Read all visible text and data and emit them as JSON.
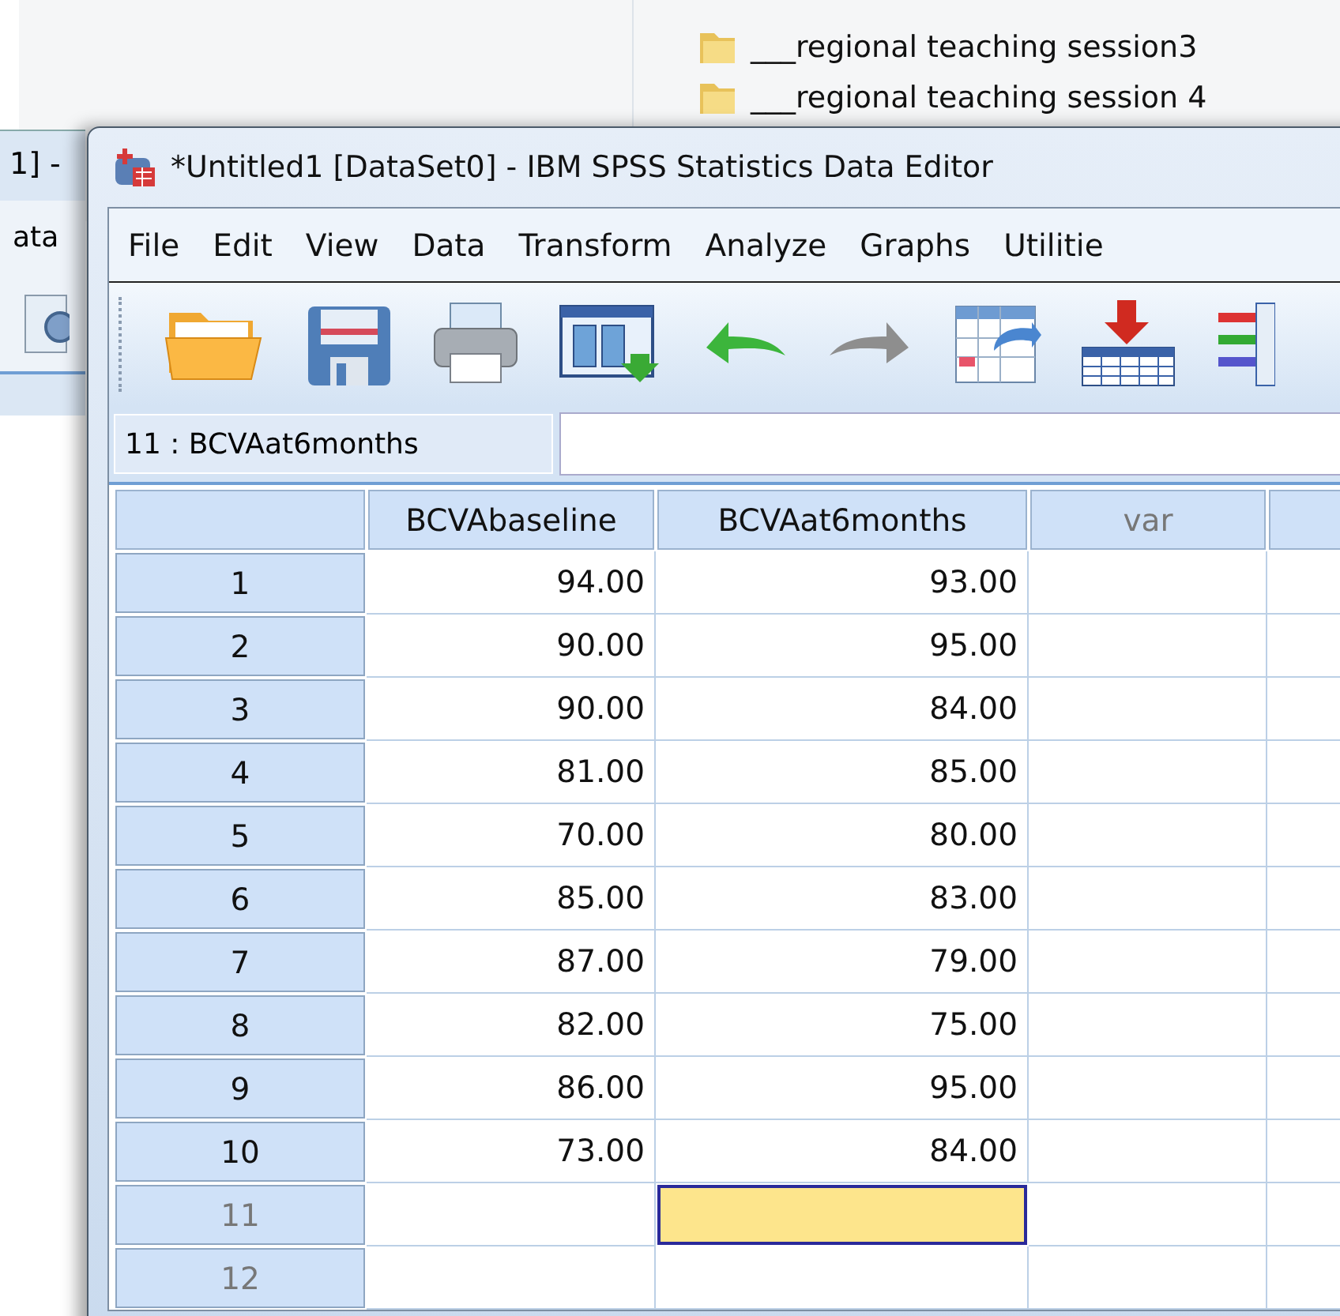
{
  "background_window": {
    "folders": [
      {
        "label": "___regional teaching session3"
      },
      {
        "label": "___regional teaching session 4"
      }
    ],
    "left_window": {
      "title": "1] -",
      "menu": "ata"
    }
  },
  "window": {
    "title": "*Untitled1 [DataSet0] - IBM SPSS Statistics Data Editor"
  },
  "menu": [
    {
      "label": "File"
    },
    {
      "label": "Edit"
    },
    {
      "label": "View"
    },
    {
      "label": "Data"
    },
    {
      "label": "Transform"
    },
    {
      "label": "Analyze"
    },
    {
      "label": "Graphs"
    },
    {
      "label": "Utilitie"
    }
  ],
  "toolbar": [
    {
      "kind": "open"
    },
    {
      "kind": "save"
    },
    {
      "kind": "print"
    },
    {
      "kind": "recall"
    },
    {
      "kind": "undo",
      "disabled": false
    },
    {
      "kind": "redo",
      "disabled": true
    },
    {
      "kind": "goto"
    },
    {
      "kind": "insert"
    },
    {
      "kind": "variables"
    }
  ],
  "cell_reference": "11 : BCVAat6months",
  "columns": [
    {
      "label": "BCVAbaseline",
      "kind": "variable"
    },
    {
      "label": "BCVAat6months",
      "kind": "variable"
    },
    {
      "label": "var",
      "kind": "empty"
    },
    {
      "kind": "empty"
    }
  ],
  "rows": [
    {
      "number": "1",
      "cells": [
        {
          "value": "94.00",
          "selected": false
        },
        {
          "value": "93.00",
          "selected": false
        },
        {
          "selected": false
        },
        {
          "selected": false
        }
      ]
    },
    {
      "number": "2",
      "cells": [
        {
          "value": "90.00",
          "selected": false
        },
        {
          "value": "95.00",
          "selected": false
        },
        {
          "selected": false
        },
        {
          "selected": false
        }
      ]
    },
    {
      "number": "3",
      "cells": [
        {
          "value": "90.00",
          "selected": false
        },
        {
          "value": "84.00",
          "selected": false
        },
        {
          "selected": false
        },
        {
          "selected": false
        }
      ]
    },
    {
      "number": "4",
      "cells": [
        {
          "value": "81.00",
          "selected": false
        },
        {
          "value": "85.00",
          "selected": false
        },
        {
          "selected": false
        },
        {
          "selected": false
        }
      ]
    },
    {
      "number": "5",
      "cells": [
        {
          "value": "70.00",
          "selected": false
        },
        {
          "value": "80.00",
          "selected": false
        },
        {
          "selected": false
        },
        {
          "selected": false
        }
      ]
    },
    {
      "number": "6",
      "cells": [
        {
          "value": "85.00",
          "selected": false
        },
        {
          "value": "83.00",
          "selected": false
        },
        {
          "selected": false
        },
        {
          "selected": false
        }
      ]
    },
    {
      "number": "7",
      "cells": [
        {
          "value": "87.00",
          "selected": false
        },
        {
          "value": "79.00",
          "selected": false
        },
        {
          "selected": false
        },
        {
          "selected": false
        }
      ]
    },
    {
      "number": "8",
      "cells": [
        {
          "value": "82.00",
          "selected": false
        },
        {
          "value": "75.00",
          "selected": false
        },
        {
          "selected": false
        },
        {
          "selected": false
        }
      ]
    },
    {
      "number": "9",
      "cells": [
        {
          "value": "86.00",
          "selected": false
        },
        {
          "value": "95.00",
          "selected": false
        },
        {
          "selected": false
        },
        {
          "selected": false
        }
      ]
    },
    {
      "number": "10",
      "cells": [
        {
          "value": "73.00",
          "selected": false
        },
        {
          "value": "84.00",
          "selected": false
        },
        {
          "selected": false
        },
        {
          "selected": false
        }
      ]
    },
    {
      "number": "11",
      "cells": [
        {
          "selected": false
        },
        {
          "selected": true
        },
        {
          "selected": false
        },
        {
          "selected": false
        }
      ]
    },
    {
      "number": "12",
      "cells": [
        {
          "selected": false
        },
        {
          "selected": false
        },
        {
          "selected": false
        },
        {
          "selected": false
        }
      ]
    }
  ]
}
